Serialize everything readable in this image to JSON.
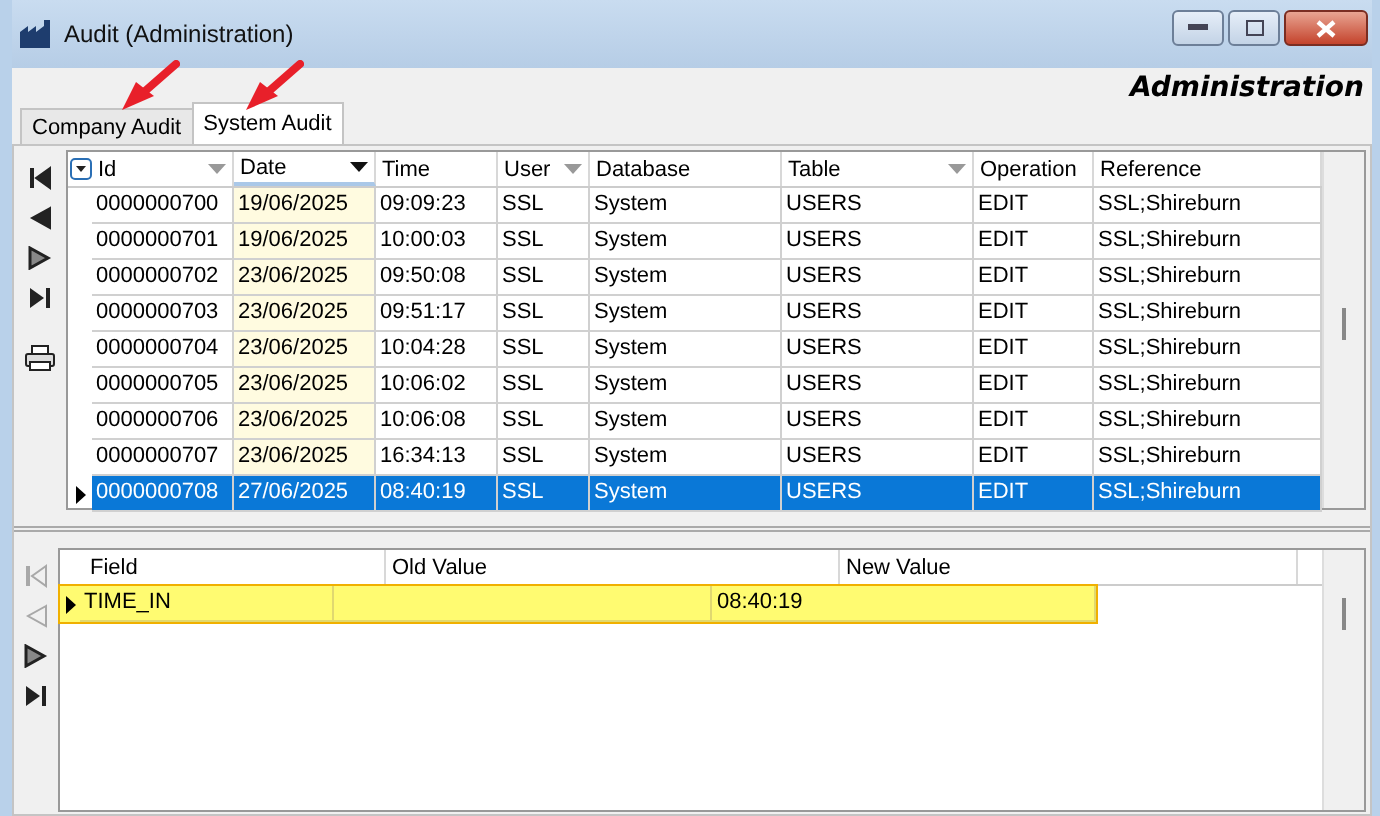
{
  "window": {
    "title": "Audit (Administration)"
  },
  "module_heading": "Administration",
  "tabs": [
    {
      "label": "Company Audit",
      "selected": false
    },
    {
      "label": "System Audit",
      "selected": true
    }
  ],
  "navigator": [
    {
      "kind": "first"
    },
    {
      "kind": "prev"
    },
    {
      "kind": "next"
    },
    {
      "kind": "last"
    },
    {
      "kind": "print"
    }
  ],
  "table": {
    "columns": [
      {
        "label": "Id",
        "filter": true,
        "sorted": false
      },
      {
        "label": "Date",
        "filter": true,
        "sorted": true
      },
      {
        "label": "Time",
        "filter": false,
        "sorted": false
      },
      {
        "label": "User",
        "filter": true,
        "sorted": false
      },
      {
        "label": "Database",
        "filter": false,
        "sorted": false
      },
      {
        "label": "Table",
        "filter": true,
        "sorted": false
      },
      {
        "label": "Operation",
        "filter": false,
        "sorted": false
      },
      {
        "label": "Reference",
        "filter": false,
        "sorted": false
      }
    ],
    "rows": [
      {
        "cells": [
          "0000000700",
          "19/06/2025",
          "09:09:23",
          "SSL",
          "System",
          "USERS",
          "EDIT",
          "SSL;Shireburn"
        ],
        "selected": false
      },
      {
        "cells": [
          "0000000701",
          "19/06/2025",
          "10:00:03",
          "SSL",
          "System",
          "USERS",
          "EDIT",
          "SSL;Shireburn"
        ],
        "selected": false
      },
      {
        "cells": [
          "0000000702",
          "23/06/2025",
          "09:50:08",
          "SSL",
          "System",
          "USERS",
          "EDIT",
          "SSL;Shireburn"
        ],
        "selected": false
      },
      {
        "cells": [
          "0000000703",
          "23/06/2025",
          "09:51:17",
          "SSL",
          "System",
          "USERS",
          "EDIT",
          "SSL;Shireburn"
        ],
        "selected": false
      },
      {
        "cells": [
          "0000000704",
          "23/06/2025",
          "10:04:28",
          "SSL",
          "System",
          "USERS",
          "EDIT",
          "SSL;Shireburn"
        ],
        "selected": false
      },
      {
        "cells": [
          "0000000705",
          "23/06/2025",
          "10:06:02",
          "SSL",
          "System",
          "USERS",
          "EDIT",
          "SSL;Shireburn"
        ],
        "selected": false
      },
      {
        "cells": [
          "0000000706",
          "23/06/2025",
          "10:06:08",
          "SSL",
          "System",
          "USERS",
          "EDIT",
          "SSL;Shireburn"
        ],
        "selected": false
      },
      {
        "cells": [
          "0000000707",
          "23/06/2025",
          "16:34:13",
          "SSL",
          "System",
          "USERS",
          "EDIT",
          "SSL;Shireburn"
        ],
        "selected": false
      },
      {
        "cells": [
          "0000000708",
          "27/06/2025",
          "08:40:19",
          "SSL",
          "System",
          "USERS",
          "EDIT",
          "SSL;Shireburn"
        ],
        "selected": true
      }
    ]
  },
  "detail_navigator": [
    {
      "kind": "first",
      "disabled": true
    },
    {
      "kind": "prev",
      "disabled": true
    },
    {
      "kind": "next",
      "disabled": false
    },
    {
      "kind": "last",
      "disabled": false
    }
  ],
  "detail_table": {
    "columns": [
      "Field",
      "Old Value",
      "New Value"
    ],
    "rows": [
      {
        "cells": [
          "TIME_IN",
          "",
          "08:40:19"
        ],
        "selected": true
      }
    ]
  }
}
